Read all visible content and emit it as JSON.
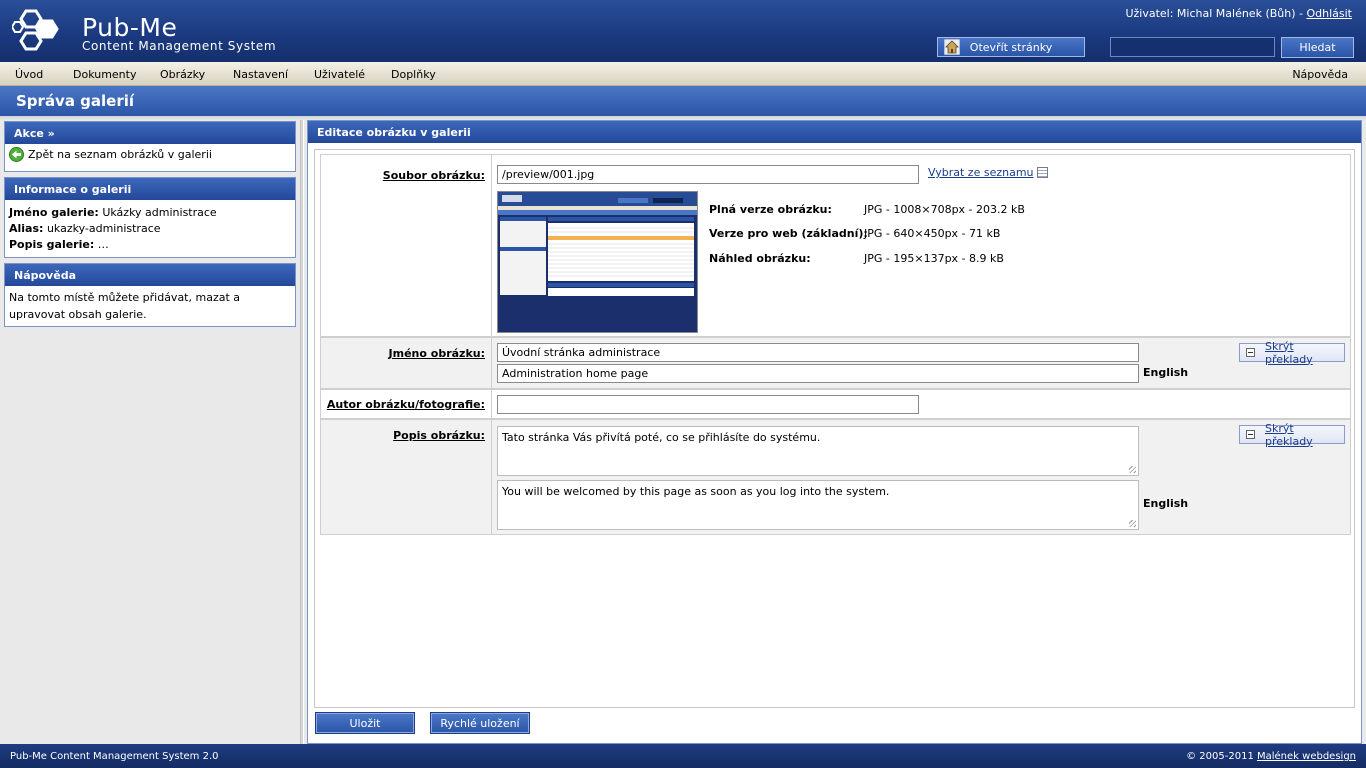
{
  "header": {
    "logo_title": "Pub-Me",
    "logo_subtitle": "Content Management System",
    "user_prefix": "Uživatel: Michal Malének (Bůh) - ",
    "logout_label": "Odhlásit",
    "open_site_label": "Otevřít stránky",
    "search_value": "",
    "search_button_label": "Hledat"
  },
  "menu": {
    "items": [
      "Úvod",
      "Dokumenty",
      "Obrázky",
      "Nastavení",
      "Uživatelé",
      "Doplňky"
    ],
    "help_label": "Nápověda"
  },
  "page_title": "Správa galerií",
  "sidebar": {
    "actions": {
      "title": "Akce »",
      "back_label": "Zpět na seznam obrázků v galerii"
    },
    "gallery_info": {
      "title": "Informace o galerii",
      "name_label": "Jméno galerie:",
      "name_value": "Ukázky administrace",
      "alias_label": "Alias:",
      "alias_value": "ukazky-administrace",
      "desc_label": "Popis galerie:",
      "desc_value": "…"
    },
    "help": {
      "title": "Nápověda",
      "text": "Na tomto místě můžete přidávat, mazat a upravovat obsah galerie."
    }
  },
  "main": {
    "title": "Editace obrázku v galerii",
    "file": {
      "label": "Soubor obrázku:",
      "value": "/preview/001.jpg",
      "choose_label": "Vybrat ze seznamu"
    },
    "versions": [
      {
        "label": "Plná verze obrázku:",
        "value": "JPG - 1008×708px - 203.2 kB"
      },
      {
        "label": "Verze pro web (základní):",
        "value": "JPG - 640×450px - 71 kB"
      },
      {
        "label": "Náhled obrázku:",
        "value": "JPG - 195×137px - 8.9 kB"
      }
    ],
    "name": {
      "label": "Jméno obrázku:",
      "value": "Úvodní stránka administrace",
      "translation_value": "Administration home page",
      "translation_lang": "English",
      "hide_translations_label": "Skrýt překlady"
    },
    "author": {
      "label": "Autor obrázku/fotografie:",
      "value": ""
    },
    "description": {
      "label": "Popis obrázku:",
      "value": "Tato stránka Vás přivítá poté, co se přihlásíte do systému.",
      "translation_value": "You will be welcomed by this page as soon as you log into the system.",
      "translation_lang": "English",
      "hide_translations_label": "Skrýt překlady"
    },
    "save_label": "Uložit",
    "quick_save_label": "Rychlé uložení"
  },
  "footer": {
    "left": "Pub-Me Content Management System 2.0",
    "right_prefix": "© 2005-2011 ",
    "right_link": "Malének webdesign"
  }
}
